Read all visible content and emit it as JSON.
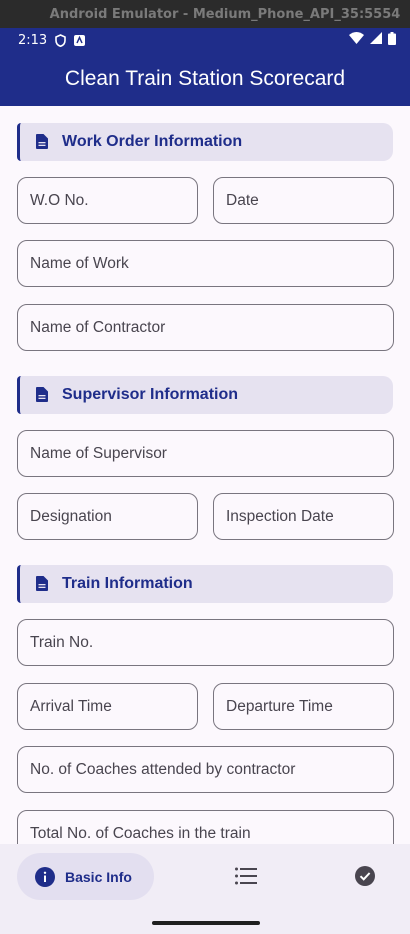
{
  "window": {
    "title": "Android Emulator - Medium_Phone_API_35:5554"
  },
  "status_bar": {
    "time": "2:13"
  },
  "app_bar": {
    "title": "Clean Train Station Scorecard"
  },
  "sections": {
    "work_order": "Work Order Information",
    "supervisor": "Supervisor Information",
    "train": "Train Information"
  },
  "fields": {
    "wo_no": "W.O No.",
    "date": "Date",
    "name_of_work": "Name of Work",
    "name_of_contractor": "Name of Contractor",
    "name_of_supervisor": "Name of Supervisor",
    "designation": "Designation",
    "inspection_date": "Inspection Date",
    "train_no": "Train No.",
    "arrival_time": "Arrival Time",
    "departure_time": "Departure Time",
    "coaches_attended": "No. of Coaches attended by contractor",
    "total_coaches": "Total No. of Coaches in the train"
  },
  "bottom_nav": {
    "basic_info": "Basic Info",
    "list_icon": "list-icon",
    "check_icon": "check-circle-icon"
  },
  "colors": {
    "primary": "#1f2d8a",
    "section_bg": "#e6e2f0",
    "surface": "#fcf8fd"
  }
}
